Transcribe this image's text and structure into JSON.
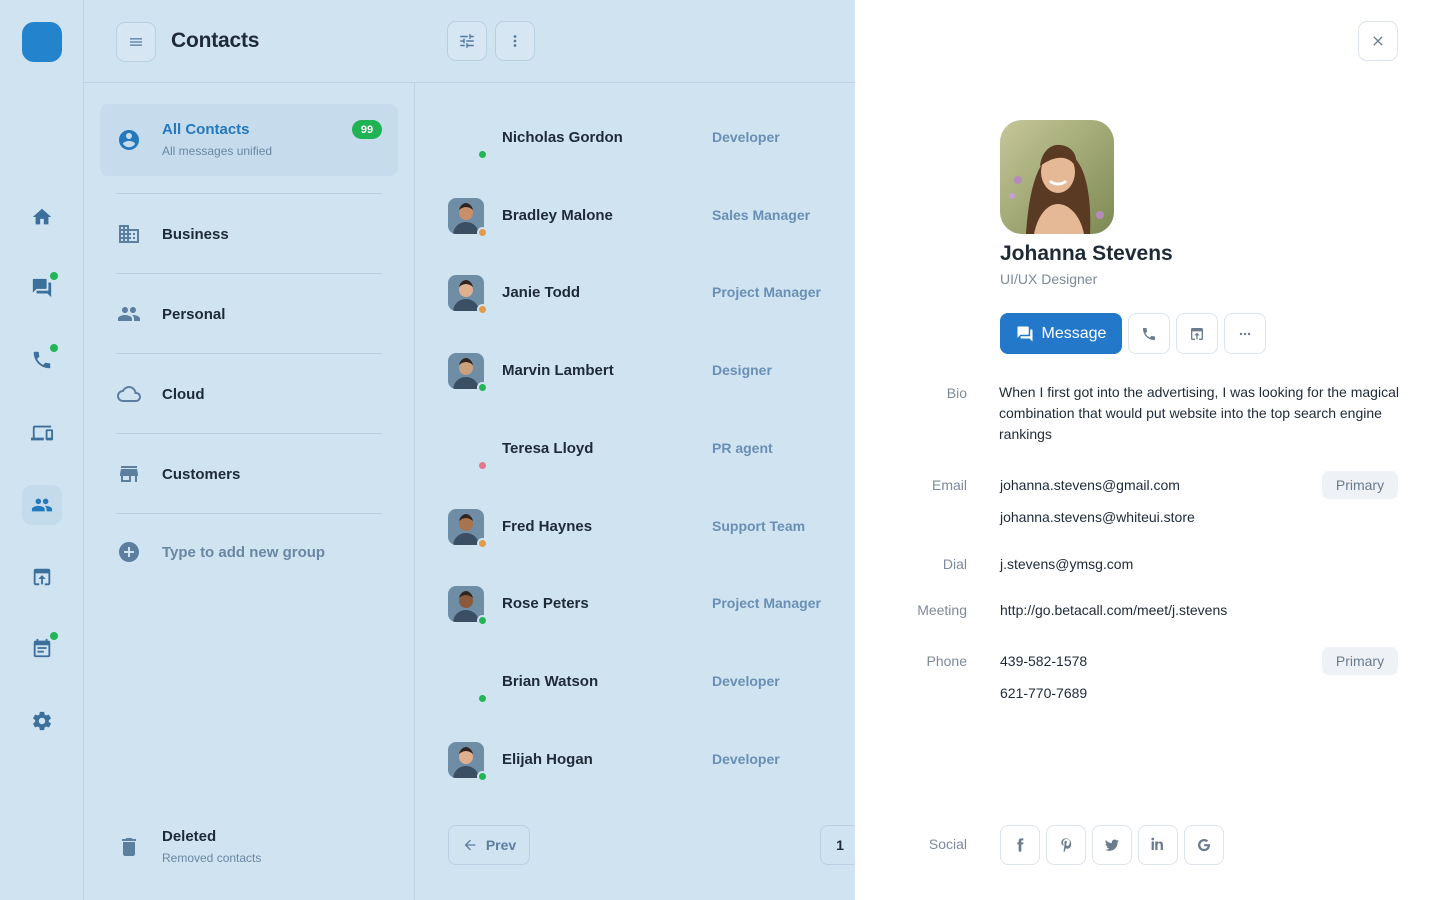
{
  "header": {
    "title": "Contacts",
    "menu_icon": "hamburger-icon",
    "filter_icon": "sliders-icon",
    "more_icon": "more-vertical-icon"
  },
  "rail": {
    "items": [
      {
        "name": "home",
        "icon": "home-icon",
        "dot": false
      },
      {
        "name": "chat",
        "icon": "chat-icon",
        "dot": true
      },
      {
        "name": "calls",
        "icon": "phone-icon",
        "dot": true
      },
      {
        "name": "devices",
        "icon": "devices-icon",
        "dot": false
      },
      {
        "name": "contacts",
        "icon": "contacts-icon",
        "dot": false,
        "active": true
      },
      {
        "name": "share",
        "icon": "share-screen-icon",
        "dot": false
      },
      {
        "name": "calendar",
        "icon": "calendar-icon",
        "dot": true
      },
      {
        "name": "settings",
        "icon": "gear-icon",
        "dot": false
      }
    ]
  },
  "groups": {
    "all": {
      "label": "All Contacts",
      "sub": "All messages unified",
      "count": "99"
    },
    "items": [
      {
        "label": "Business",
        "icon": "building-icon"
      },
      {
        "label": "Personal",
        "icon": "people-icon"
      },
      {
        "label": "Cloud",
        "icon": "cloud-icon"
      },
      {
        "label": "Customers",
        "icon": "store-icon"
      }
    ],
    "add_label": "Type to add new group",
    "deleted": {
      "label": "Deleted",
      "sub": "Removed contacts"
    }
  },
  "contacts": [
    {
      "name": "Nicholas Gordon",
      "role": "Developer",
      "status": "online",
      "avatar": false
    },
    {
      "name": "Bradley Malone",
      "role": "Sales Manager",
      "status": "away",
      "avatar": true
    },
    {
      "name": "Janie Todd",
      "role": "Project Manager",
      "status": "away",
      "avatar": true
    },
    {
      "name": "Marvin Lambert",
      "role": "Designer",
      "status": "online",
      "avatar": true
    },
    {
      "name": "Teresa Lloyd",
      "role": "PR agent",
      "status": "busy",
      "avatar": false
    },
    {
      "name": "Fred Haynes",
      "role": "Support Team",
      "status": "away",
      "avatar": true
    },
    {
      "name": "Rose Peters",
      "role": "Project Manager",
      "status": "online",
      "avatar": true
    },
    {
      "name": "Brian Watson",
      "role": "Developer",
      "status": "online",
      "avatar": false
    },
    {
      "name": "Elijah Hogan",
      "role": "Developer",
      "status": "online",
      "avatar": true
    }
  ],
  "pagination": {
    "prev_label": "Prev",
    "page": "1"
  },
  "colors": {
    "online": "#23b455",
    "away": "#e29a4c",
    "busy": "#e27a8e",
    "accent": "#2378c9"
  },
  "profile": {
    "name": "Johanna Stevens",
    "role": "UI/UX Designer",
    "message_label": "Message",
    "fields": {
      "bio_label": "Bio",
      "bio": "When I first got into the advertising, I was looking for the magical combination that would put website into the top search engine rankings",
      "email_label": "Email",
      "email_primary": "johanna.stevens@gmail.com",
      "email_secondary": "johanna.stevens@whiteui.store",
      "primary_tag": "Primary",
      "dial_label": "Dial",
      "dial": "j.stevens@ymsg.com",
      "meeting_label": "Meeting",
      "meeting": "http://go.betacall.com/meet/j.stevens",
      "phone_label": "Phone",
      "phone_primary": "439-582-1578",
      "phone_secondary": "621-770-7689",
      "social_label": "Social"
    },
    "social": [
      "facebook-icon",
      "pinterest-icon",
      "twitter-icon",
      "linkedin-icon",
      "google-icon"
    ]
  }
}
